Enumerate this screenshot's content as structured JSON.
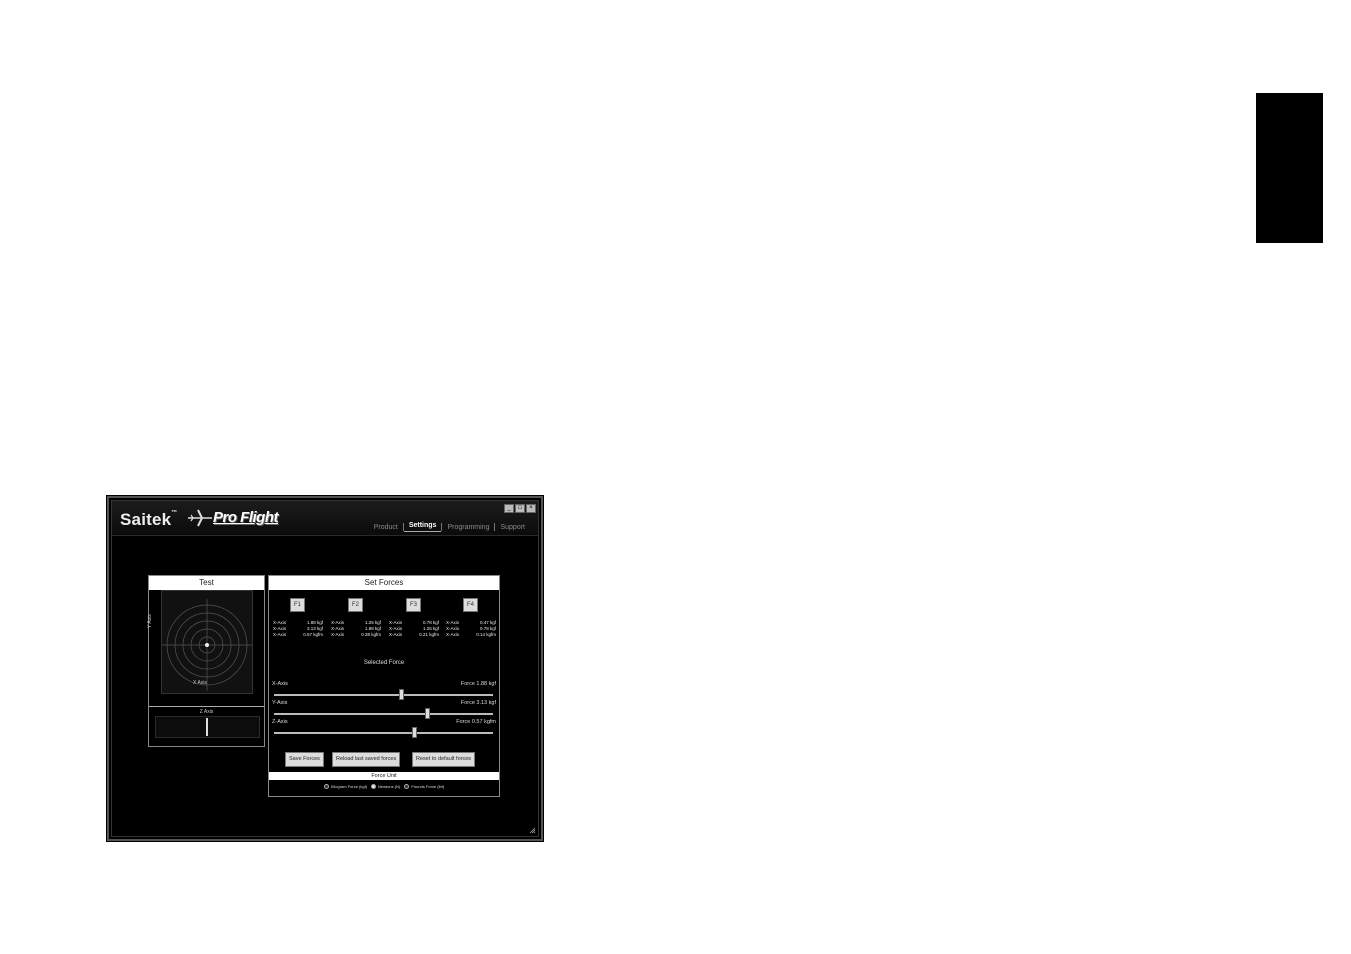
{
  "app": {
    "logo": "Saitek",
    "logo_tm": "™",
    "product_logo": "Pro Flight"
  },
  "window_controls": {
    "minimize": "_",
    "maximize": "□",
    "close": "×"
  },
  "nav": {
    "items": [
      {
        "label": "Product",
        "active": false
      },
      {
        "label": "Settings",
        "active": true
      },
      {
        "label": "Programming",
        "active": false
      },
      {
        "label": "Support",
        "active": false
      }
    ]
  },
  "test_panel": {
    "title": "Test",
    "y_axis_label": "Y Axis",
    "x_axis_label": "X Axis",
    "z_axis_label": "Z Axis"
  },
  "set_forces": {
    "title": "Set Forces",
    "presets": [
      {
        "label": "F1",
        "rows": [
          [
            "X-Axis",
            "1.88 kgf"
          ],
          [
            "X-Axis",
            "3.13 kgf"
          ],
          [
            "X-Axis",
            "0.57 kgfm"
          ]
        ]
      },
      {
        "label": "F2",
        "rows": [
          [
            "X-Axis",
            "1.25 kgf"
          ],
          [
            "X-Axis",
            "1.88 kgf"
          ],
          [
            "X-Axis",
            "0.38 kgfm"
          ]
        ]
      },
      {
        "label": "F3",
        "rows": [
          [
            "X-Axis",
            "0.78 kgf"
          ],
          [
            "X-Axis",
            "1.25 kgf"
          ],
          [
            "X-Axis",
            "0.21 kgfm"
          ]
        ]
      },
      {
        "label": "F4",
        "rows": [
          [
            "X-Axis",
            "0.47 kgf"
          ],
          [
            "X-Axis",
            "0.78 kgf"
          ],
          [
            "X-Axis",
            "0.14 kgfm"
          ]
        ]
      }
    ],
    "selected_force_label": "Selected Force",
    "axes": [
      {
        "label": "X-Axis",
        "value": "Force 1.88 kgf",
        "level": 0.58
      },
      {
        "label": "Y-Axis",
        "value": "Force 3.13 kgf",
        "level": 0.7
      },
      {
        "label": "Z-Axis",
        "value": "Force 0.57 kgfm",
        "level": 0.64
      }
    ],
    "buttons": {
      "save": "Save Forces",
      "reload": "Reload last saved forces",
      "reset": "Reset to default forces"
    },
    "force_unit_title": "Force Unit",
    "units": [
      {
        "label": "Kilogram Force (kgf)",
        "selected": false
      },
      {
        "label": "Newtons (N)",
        "selected": true
      },
      {
        "label": "Pounds Force (lbf)",
        "selected": false
      }
    ]
  }
}
